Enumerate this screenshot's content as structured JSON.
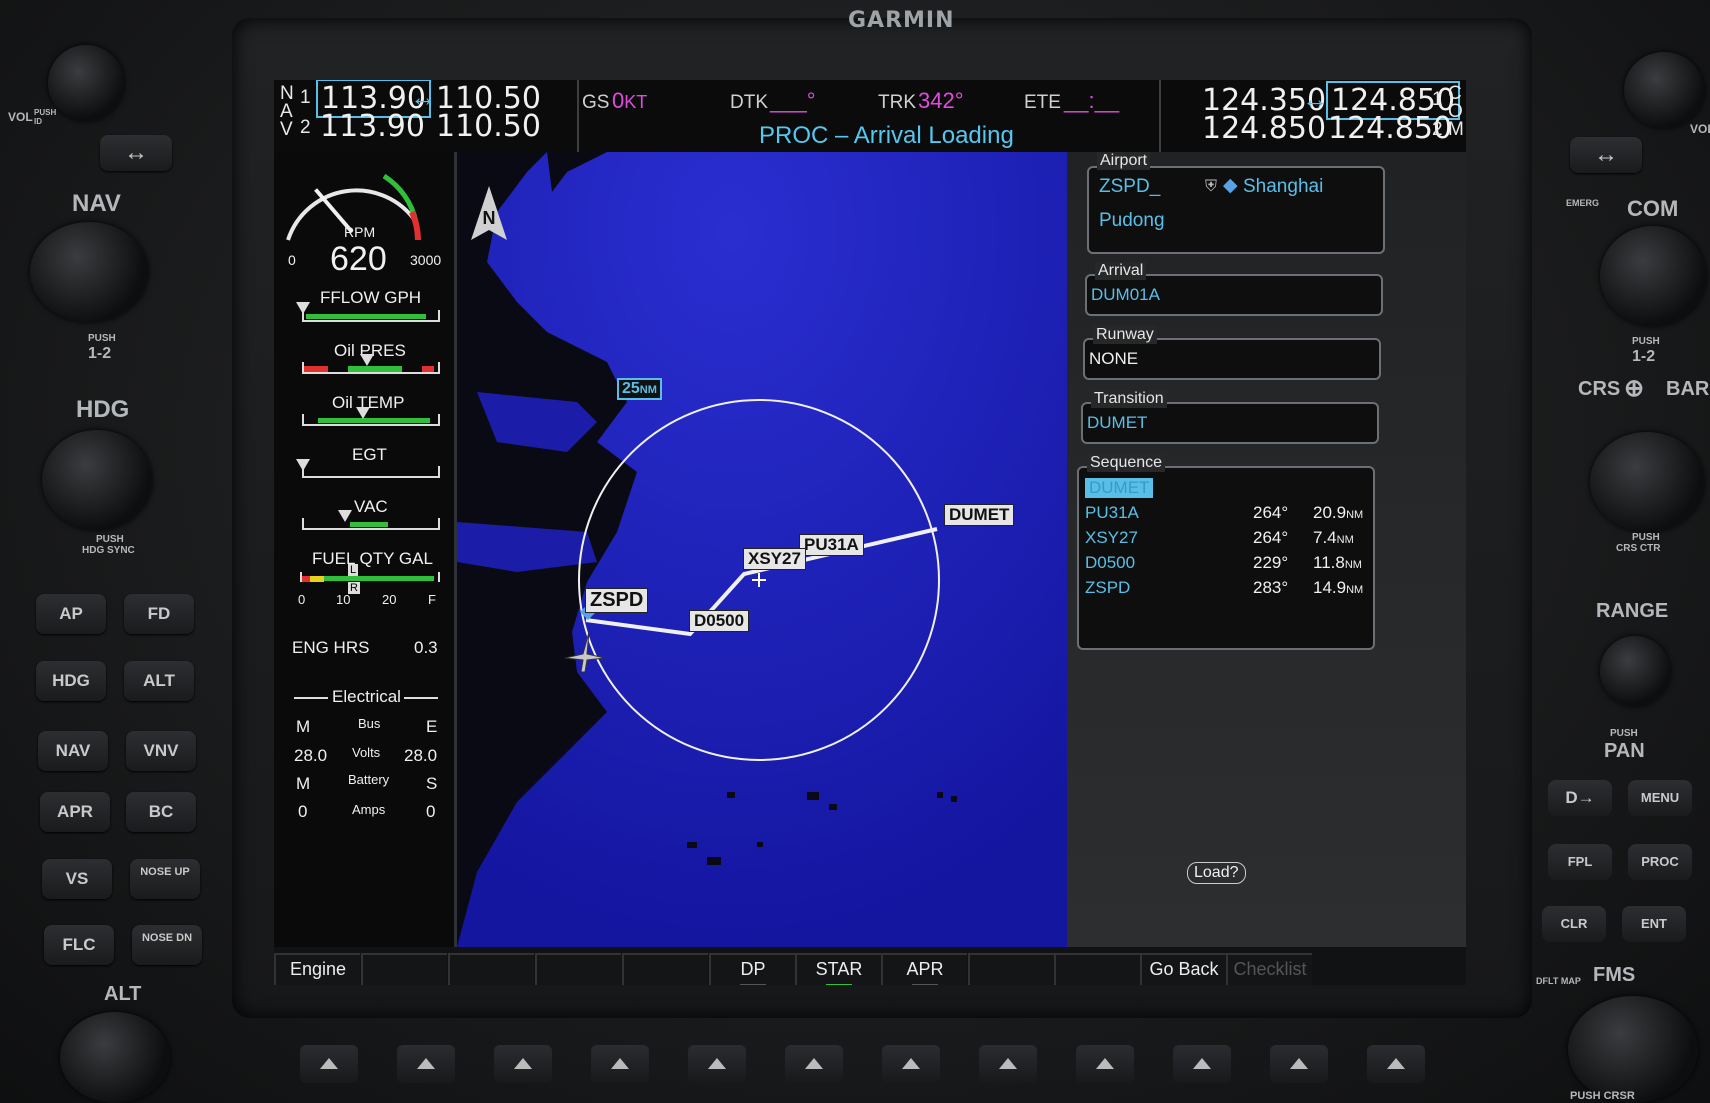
{
  "brand": "GARMIN",
  "nav": {
    "label_n": "N",
    "label_a": "A",
    "label_v": "V",
    "idx1": "1",
    "idx2": "2",
    "nav1_active": "113.90",
    "nav1_standby": "110.50",
    "nav2_active": "113.90",
    "nav2_standby": "110.50"
  },
  "com": {
    "com1_active": "124.350",
    "com1_standby": "124.850",
    "com2_active": "124.850",
    "com2_standby": "124.850",
    "idx1": "1",
    "idx2": "2",
    "label_c": "C",
    "label_o": "O",
    "label_m": "M"
  },
  "topbar": {
    "gs_label": "GS",
    "gs_value": "0",
    "gs_unit": "KT",
    "dtk_label": "DTK",
    "dtk_value": "___°",
    "trk_label": "TRK",
    "trk_value": "342°",
    "ete_label": "ETE",
    "ete_value": "__:__",
    "page_title": "PROC – Arrival Loading"
  },
  "engine": {
    "rpm_label": "RPM",
    "rpm_value": "620",
    "rpm_min": "0",
    "rpm_max": "3000",
    "fflow_label": "FFLOW GPH",
    "oil_pres_label": "Oil PRES",
    "oil_temp_label": "Oil TEMP",
    "egt_label": "EGT",
    "vac_label": "VAC",
    "fuel_label": "FUEL QTY GAL",
    "fuel_ticks": [
      "0",
      "10",
      "20",
      "F"
    ],
    "fuel_marker_l": "L",
    "fuel_marker_r": "R",
    "eng_hrs_label": "ENG HRS",
    "eng_hrs_value": "0.3",
    "electrical_label": "Electrical",
    "elec": {
      "m1": "M",
      "bus": "Bus",
      "e": "E",
      "volts_m": "28.0",
      "volts": "Volts",
      "volts_e": "28.0",
      "m2": "M",
      "battery": "Battery",
      "s": "S",
      "amps_m": "0",
      "amps": "Amps",
      "amps_s": "0"
    },
    "rpm_fraction": 0.21
  },
  "map": {
    "north": "N",
    "range_value": "25",
    "range_unit": "NM",
    "waypoints": {
      "dumet": "DUMET",
      "pu31a": "PU31A",
      "xsy27": "XSY27",
      "d0500": "D0500",
      "zspd": "ZSPD"
    }
  },
  "panel": {
    "airport_title": "Airport",
    "airport_ident": "ZSPD",
    "airport_ident_suffix": "_",
    "airport_city": "Shanghai",
    "airport_name": "Pudong",
    "arrival_title": "Arrival",
    "arrival_value": "DUM01A",
    "runway_title": "Runway",
    "runway_value": "NONE",
    "transition_title": "Transition",
    "transition_value": "DUMET",
    "sequence_title": "Sequence",
    "sequence": [
      {
        "wp": "DUMET",
        "crs": "",
        "dist": "",
        "unit": ""
      },
      {
        "wp": "PU31A",
        "crs": "264°",
        "dist": "20.9",
        "unit": "NM"
      },
      {
        "wp": "XSY27",
        "crs": "264°",
        "dist": "7.4",
        "unit": "NM"
      },
      {
        "wp": "D0500",
        "crs": "229°",
        "dist": "11.8",
        "unit": "NM"
      },
      {
        "wp": "ZSPD",
        "crs": "283°",
        "dist": "14.9",
        "unit": "NM"
      }
    ],
    "load_prompt": "Load?"
  },
  "softkeys": [
    "Engine",
    "",
    "",
    "",
    "",
    "DP",
    "STAR",
    "APR",
    "",
    "",
    "Go Back",
    "Checklist"
  ],
  "left_controls": {
    "vol": "VOL",
    "push_id": "PUSH ID",
    "nav": "NAV",
    "push12": "PUSH",
    "one_two": "1-2",
    "hdg": "HDG",
    "hdg_push": "PUSH",
    "hdg_sync": "HDG SYNC",
    "buttons": [
      [
        "AP",
        "FD"
      ],
      [
        "HDG",
        "ALT"
      ],
      [
        "NAV",
        "VNV"
      ],
      [
        "APR",
        "BC"
      ],
      [
        "VS",
        "NOSE UP"
      ],
      [
        "FLC",
        "NOSE DN"
      ]
    ],
    "alt": "ALT"
  },
  "right_controls": {
    "vol": "VOL",
    "emerg": "EMERG",
    "com": "COM",
    "push12": "PUSH",
    "one_two": "1-2",
    "crs": "CRS",
    "baro": "BARO",
    "push": "PUSH",
    "crs_ctr": "CRS CTR",
    "range": "RANGE",
    "push_pan": "PUSH",
    "pan": "PAN",
    "direct": "D→",
    "menu": "MENU",
    "fpl": "FPL",
    "proc": "PROC",
    "clr": "CLR",
    "ent": "ENT",
    "dflt_map": "DFLT MAP",
    "fms": "FMS",
    "push_crsr": "PUSH CRSR"
  },
  "colors": {
    "cyan": "#58c0e8",
    "magenta": "#e04ce0",
    "map_water": "#1c1eb3",
    "land": "#0a0a14"
  }
}
